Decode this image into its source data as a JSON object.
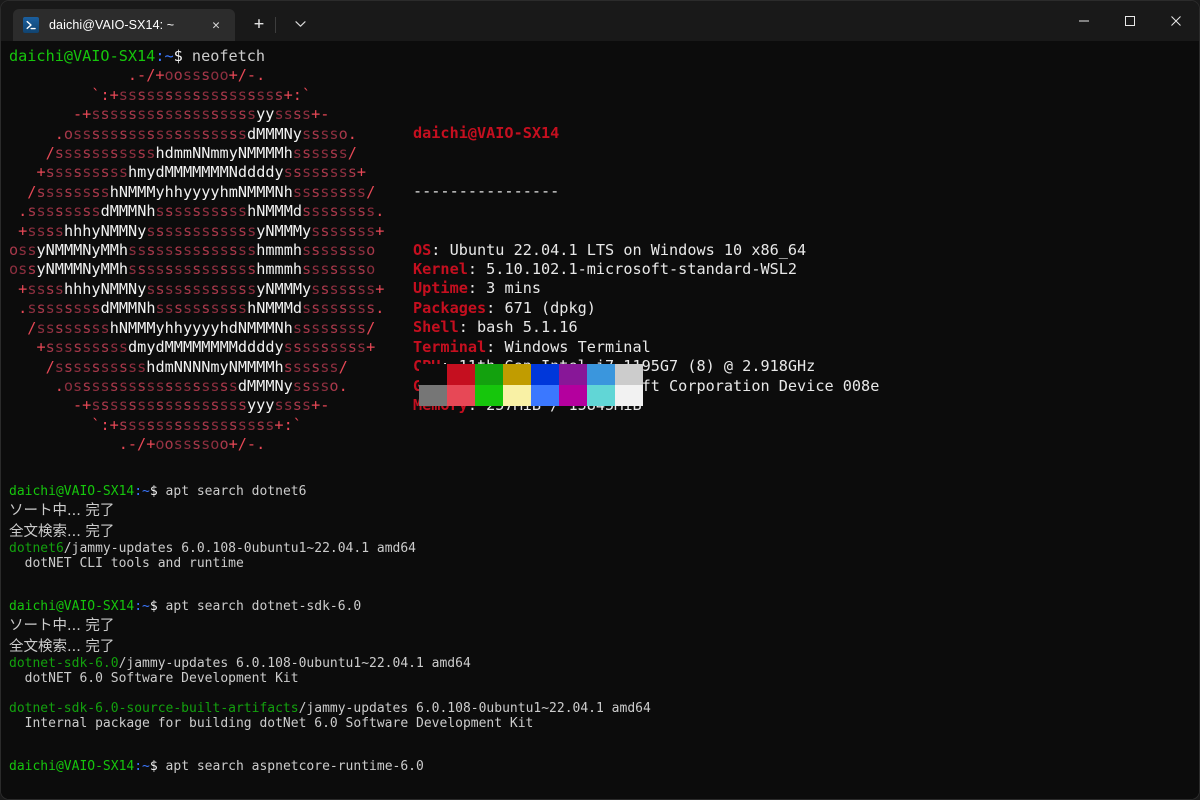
{
  "window": {
    "titlebar_bg": "#191919",
    "tab_bg": "#2c2c2c",
    "terminal_bg": "#0c0c0c",
    "tab": {
      "icon": "powershell-prompt-icon",
      "title": "daichi@VAIO-SX14: ~",
      "close_glyph": "✕"
    },
    "new_tab_glyph": "+",
    "tab_menu_glyph": "⌄",
    "controls": {
      "minimize": "—",
      "maximize": "□",
      "close": "✕"
    }
  },
  "terminal": {
    "prompt": {
      "user_host": "daichi@VAIO-SX14",
      "path": ":~",
      "sigil": "$"
    },
    "commands": {
      "neofetch": "neofetch",
      "apt_dotnet6": "apt search dotnet6",
      "apt_sdk": "apt search dotnet-sdk-6.0",
      "apt_aspnet": "apt search aspnetcore-runtime-6.0"
    },
    "apt_messages": {
      "sorting": "ソート中... 完了",
      "fulltext": "全文検索... 完了"
    },
    "results": [
      {
        "package": "dotnet6",
        "suffix": "/jammy-updates 6.0.108-0ubuntu1~22.04.1 amd64",
        "description": "  dotNET CLI tools and runtime"
      },
      {
        "package": "dotnet-sdk-6.0",
        "suffix": "/jammy-updates 6.0.108-0ubuntu1~22.04.1 amd64",
        "description": "  dotNET 6.0 Software Development Kit"
      },
      {
        "package": "dotnet-sdk-6.0-source-built-artifacts",
        "suffix": "/jammy-updates 6.0.108-0ubuntu1~22.04.1 amd64",
        "description": "  Internal package for building dotNet 6.0 Software Development Kit"
      }
    ]
  },
  "neofetch": {
    "header": "daichi@VAIO-SX14",
    "rule": "----------------",
    "fields": [
      {
        "label": "OS",
        "value": "Ubuntu 22.04.1 LTS on Windows 10 x86_64"
      },
      {
        "label": "Kernel",
        "value": "5.10.102.1-microsoft-standard-WSL2"
      },
      {
        "label": "Uptime",
        "value": "3 mins"
      },
      {
        "label": "Packages",
        "value": "671 (dpkg)"
      },
      {
        "label": "Shell",
        "value": "bash 5.1.16"
      },
      {
        "label": "Terminal",
        "value": "Windows Terminal"
      },
      {
        "label": "CPU",
        "value": "11th Gen Intel i7-1195G7 (8) @ 2.918GHz"
      },
      {
        "label": "GPU",
        "value": "e306:00:00.0 Microsoft Corporation Device 008e"
      },
      {
        "label": "Memory",
        "value": "257MiB / 15845MiB"
      }
    ],
    "palette": {
      "row1": [
        "#0c0c0c",
        "#c50f1f",
        "#13a10e",
        "#c19c00",
        "#0037da",
        "#881798",
        "#3a96dd",
        "#cccccc"
      ],
      "row2": [
        "#767676",
        "#e74856",
        "#16c60c",
        "#f9f1a5",
        "#3b78ff",
        "#b4009e",
        "#61d6d6",
        "#f2f2f2"
      ]
    },
    "ascii_art": [
      "             .-/+oosssoo+/-.",
      "         `:+ssssssssssssssssss+:`",
      "       -+ssssssssssssssssssyyssss+-",
      "     .osssssssssssssssssssdMMMNysssso.",
      "    /ssssssssssshdmmNNmmyNMMMMhssssss/",
      "   +ssssssssshmydMMMMMMMNddddyssssssss+",
      "  /sssssssshNMMMyhhyyyyhmNMMMNhssssssss/",
      " .ssssssssdMMMNhsssssssssshNMMMdssssssss.",
      " +sssshhhyNMMNyssssssssssssyNMMMysssssss+",
      "ossyNMMMNyMMhsssssssssssssshmmmhssssssso",
      "ossyNMMMNyMMhsssssssssssssshmmmhssssssso",
      " +sssshhhyNMMNyssssssssssssyNMMMysssssss+",
      " .ssssssssdMMMNhsssssssssshNMMMdssssssss.",
      "  /sssssssshNMMMyhhyyyyhdNMMMNhssssssss/",
      "   +sssssssssdmydMMMMMMMMddddysssssssss+",
      "    /sssssssssshdmNNNNmyNMMMMhssssss/",
      "     .ossssssssssssssssssdMMMNysssso.",
      "       -+sssssssssssssssssyyyssss+-",
      "         `:+sssssssssssssssss+:`",
      "            .-/+oossssoo+/-."
    ]
  }
}
